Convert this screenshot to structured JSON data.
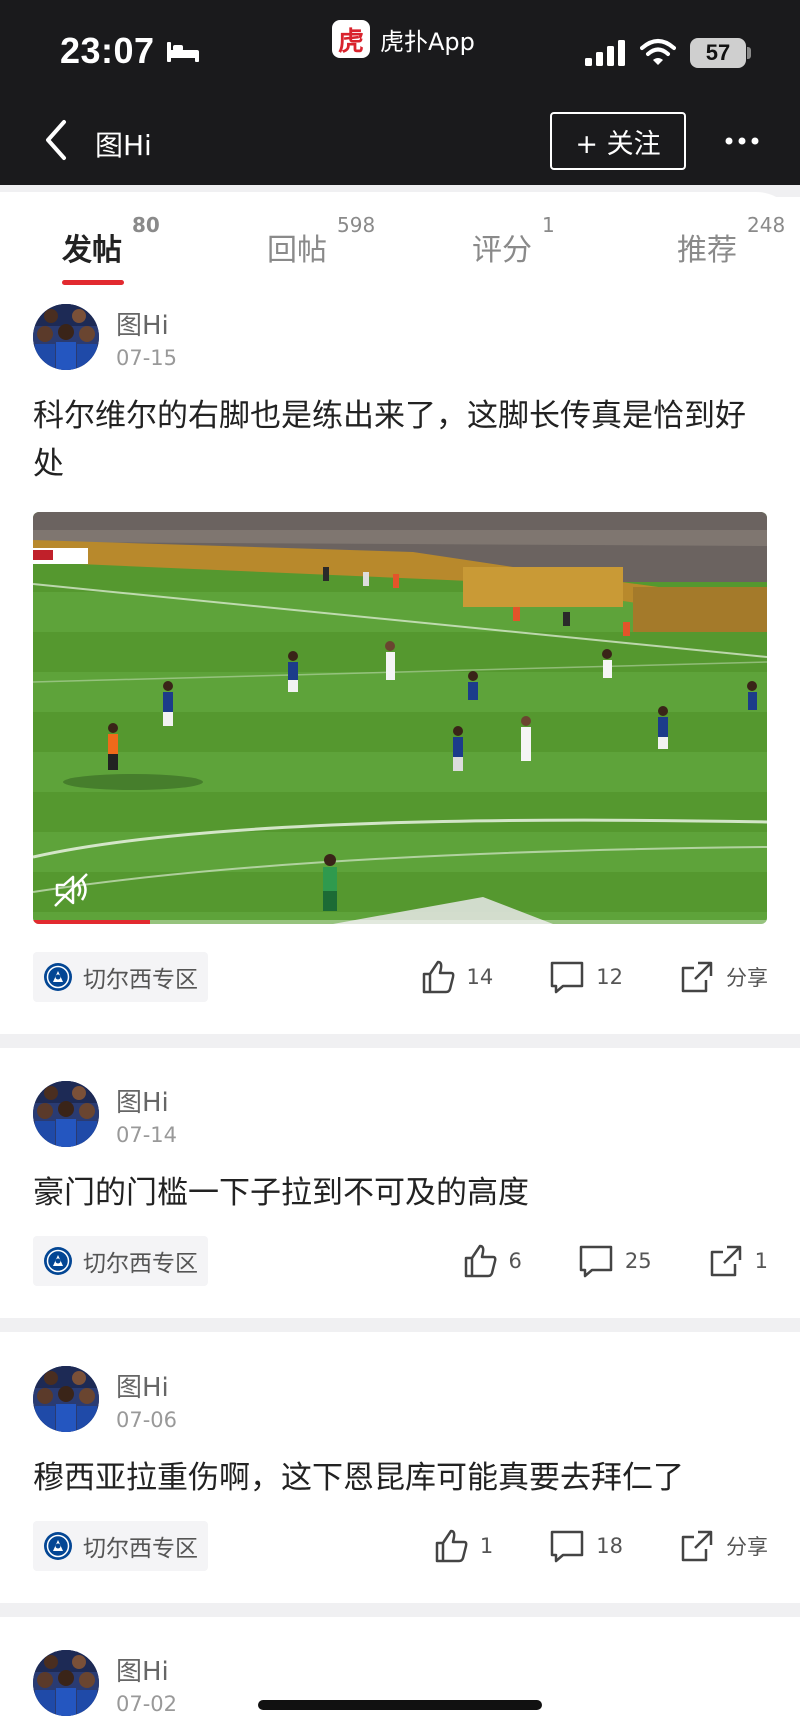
{
  "status": {
    "time": "23:07",
    "battery": "57"
  },
  "app": {
    "logo_text": "虎",
    "name": "虎扑App"
  },
  "nav": {
    "title": "图Hi",
    "follow": "+ 关注"
  },
  "tabs": [
    {
      "label": "发帖",
      "count": "80",
      "active": true
    },
    {
      "label": "回帖",
      "count": "598"
    },
    {
      "label": "评分",
      "count": "1"
    },
    {
      "label": "推荐",
      "count": "248"
    }
  ],
  "posts": [
    {
      "author": "图Hi",
      "date": "07-15",
      "text": "科尔维尔的右脚也是练出来了，这脚长传真是恰到好处",
      "has_video": true,
      "video_progress": 0.16,
      "forum": "切尔西专区",
      "likes": "14",
      "comments": "12",
      "share": "分享"
    },
    {
      "author": "图Hi",
      "date": "07-14",
      "text": "豪门的门槛一下子拉到不可及的高度",
      "forum": "切尔西专区",
      "likes": "6",
      "comments": "25",
      "share": "1"
    },
    {
      "author": "图Hi",
      "date": "07-06",
      "text": "穆西亚拉重伤啊，这下恩昆库可能真要去拜仁了",
      "forum": "切尔西专区",
      "likes": "1",
      "comments": "18",
      "share": "分享"
    },
    {
      "author": "图Hi",
      "date": "07-02"
    }
  ],
  "icons": {
    "back": "chevron-left-icon",
    "more": "more-dots-icon",
    "like": "thumbs-up-icon",
    "comment": "comment-icon",
    "share": "share-icon",
    "mute": "mute-icon",
    "forum": "chelsea-crest-icon",
    "bed": "sleep-mode-icon",
    "signal": "signal-icon",
    "wifi": "wifi-icon"
  },
  "colors": {
    "accent": "#e22a2f",
    "header_bg": "#1a1a1c",
    "chelsea_blue": "#034694"
  }
}
